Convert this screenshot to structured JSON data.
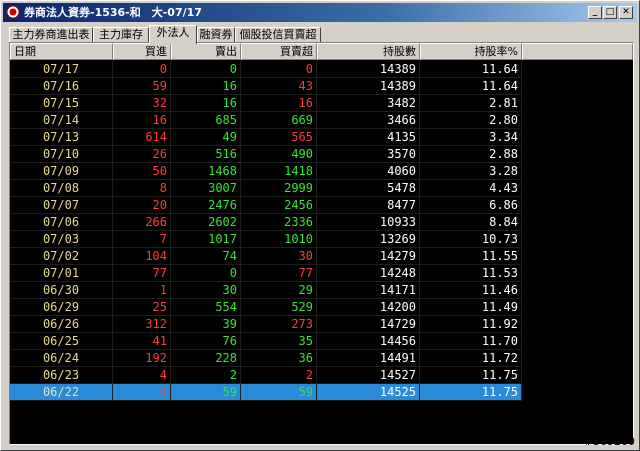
{
  "window": {
    "title": "券商法人資券-1536-和　大-07/17",
    "minimize_glyph": "_",
    "maximize_glyph": "□",
    "close_glyph": "✕"
  },
  "tabs": [
    {
      "label": "主力券商進出表"
    },
    {
      "label": "主力庫存"
    },
    {
      "label": "外法人"
    },
    {
      "label": "融資券"
    },
    {
      "label": "個股投信買賣超"
    }
  ],
  "table": {
    "headers": [
      "日期",
      "買進",
      "賣出",
      "買賣超",
      "持股數",
      "持股率%"
    ],
    "rows": [
      {
        "date": "07/17",
        "buy": "0",
        "sell": "0",
        "net": "0",
        "shares": "14389",
        "pct": "11.64"
      },
      {
        "date": "07/16",
        "buy": "59",
        "sell": "16",
        "net": "43",
        "shares": "14389",
        "pct": "11.64"
      },
      {
        "date": "07/15",
        "buy": "32",
        "sell": "16",
        "net": "16",
        "shares": "3482",
        "pct": "2.81"
      },
      {
        "date": "07/14",
        "buy": "16",
        "sell": "685",
        "net": "669",
        "shares": "3466",
        "pct": "2.80"
      },
      {
        "date": "07/13",
        "buy": "614",
        "sell": "49",
        "net": "565",
        "shares": "4135",
        "pct": "3.34"
      },
      {
        "date": "07/10",
        "buy": "26",
        "sell": "516",
        "net": "490",
        "shares": "3570",
        "pct": "2.88"
      },
      {
        "date": "07/09",
        "buy": "50",
        "sell": "1468",
        "net": "1418",
        "shares": "4060",
        "pct": "3.28"
      },
      {
        "date": "07/08",
        "buy": "8",
        "sell": "3007",
        "net": "2999",
        "shares": "5478",
        "pct": "4.43"
      },
      {
        "date": "07/07",
        "buy": "20",
        "sell": "2476",
        "net": "2456",
        "shares": "8477",
        "pct": "6.86"
      },
      {
        "date": "07/06",
        "buy": "266",
        "sell": "2602",
        "net": "2336",
        "shares": "10933",
        "pct": "8.84"
      },
      {
        "date": "07/03",
        "buy": "7",
        "sell": "1017",
        "net": "1010",
        "shares": "13269",
        "pct": "10.73"
      },
      {
        "date": "07/02",
        "buy": "104",
        "sell": "74",
        "net": "30",
        "shares": "14279",
        "pct": "11.55"
      },
      {
        "date": "07/01",
        "buy": "77",
        "sell": "0",
        "net": "77",
        "shares": "14248",
        "pct": "11.53"
      },
      {
        "date": "06/30",
        "buy": "1",
        "sell": "30",
        "net": "29",
        "shares": "14171",
        "pct": "11.46"
      },
      {
        "date": "06/29",
        "buy": "25",
        "sell": "554",
        "net": "529",
        "shares": "14200",
        "pct": "11.49"
      },
      {
        "date": "06/26",
        "buy": "312",
        "sell": "39",
        "net": "273",
        "shares": "14729",
        "pct": "11.92"
      },
      {
        "date": "06/25",
        "buy": "41",
        "sell": "76",
        "net": "35",
        "shares": "14456",
        "pct": "11.70"
      },
      {
        "date": "06/24",
        "buy": "192",
        "sell": "228",
        "net": "36",
        "shares": "14491",
        "pct": "11.72"
      },
      {
        "date": "06/23",
        "buy": "4",
        "sell": "2",
        "net": "2",
        "shares": "14527",
        "pct": "11.75"
      },
      {
        "date": "06/22",
        "buy": "0",
        "sell": "59",
        "net": "59",
        "shares": "14525",
        "pct": "11.75"
      }
    ]
  },
  "watermark": "#369260",
  "colors": {
    "buy": "#ff3b3b",
    "sell": "#36e436",
    "selected_row": "#2a8ad8",
    "date": "#e8d890"
  }
}
